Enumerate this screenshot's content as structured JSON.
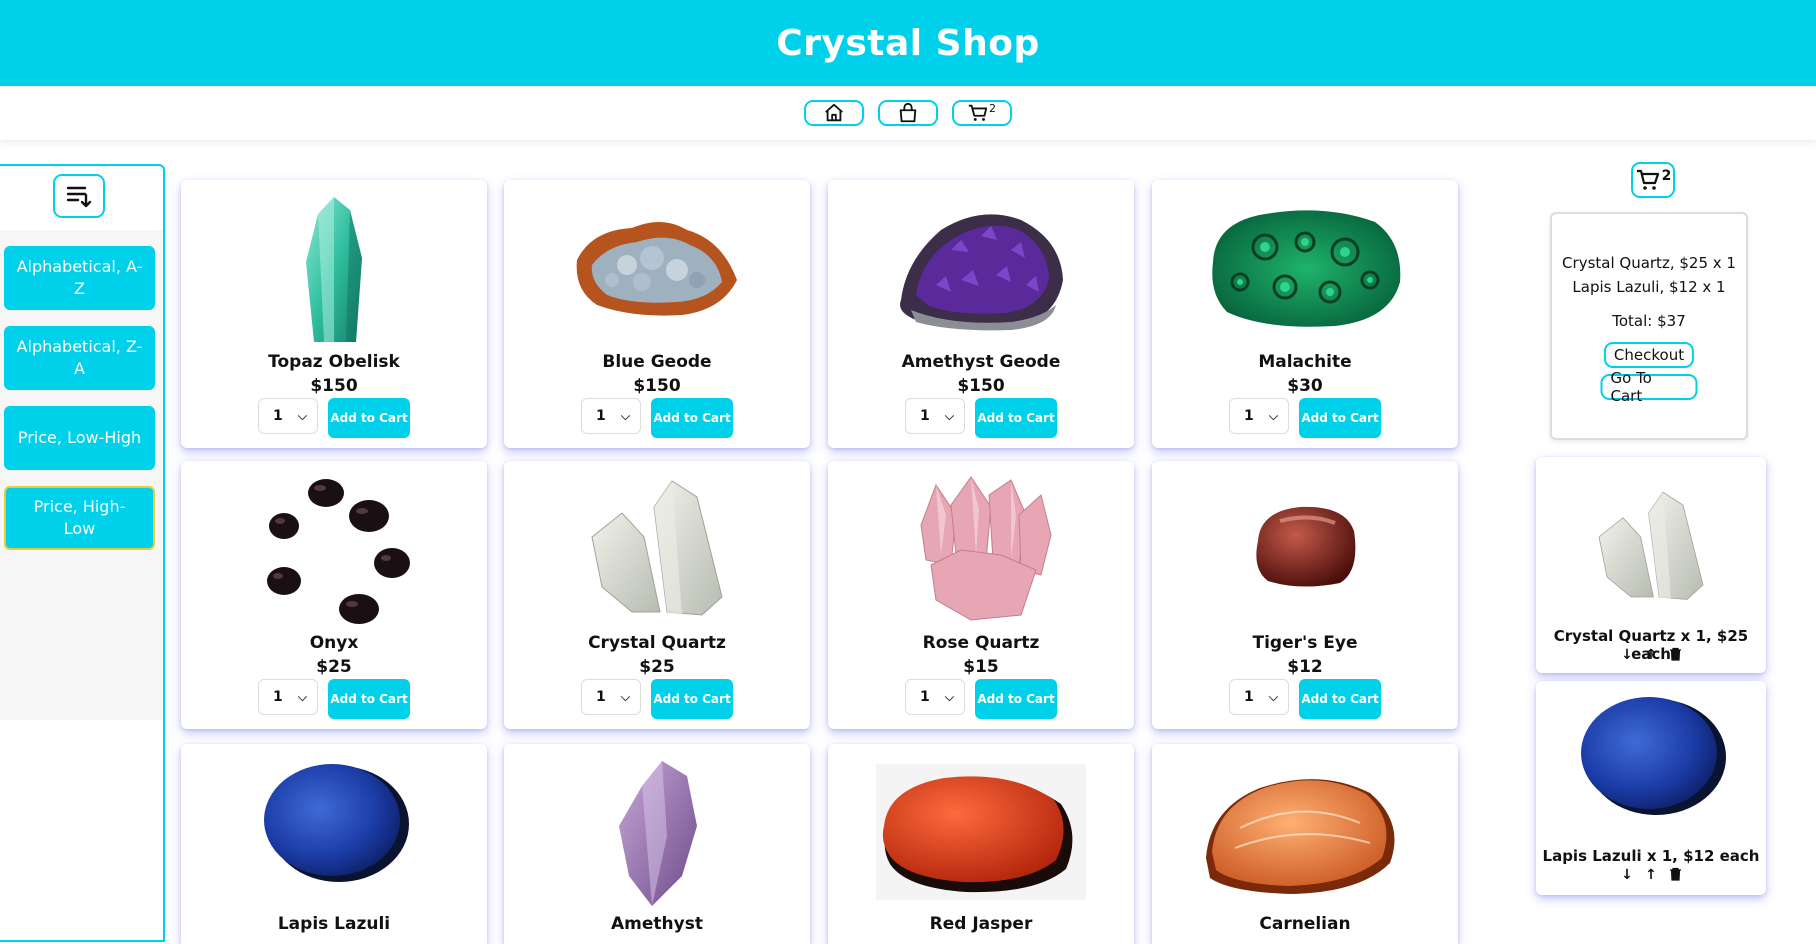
{
  "app": {
    "title": "Crystal Shop",
    "accent": "#00d1ea",
    "active_outline": "#e6cd38"
  },
  "nav": [
    {
      "icon": "home-icon"
    },
    {
      "icon": "shopping-bag-icon"
    },
    {
      "icon": "cart-icon",
      "count": "2"
    }
  ],
  "sidebar": {
    "sort_icon": "sort-descending-icon",
    "options": [
      {
        "label": "Alphabetical, A-Z",
        "active": false
      },
      {
        "label": "Alphabetical, Z-A",
        "active": false
      },
      {
        "label": "Price, Low-High",
        "active": false
      },
      {
        "label": "Price, High-Low",
        "active": true
      }
    ]
  },
  "products": [
    {
      "name": "Topaz Obelisk",
      "price": "$150",
      "qty": "1",
      "button": "Add to Cart",
      "image": "green-crystal-point"
    },
    {
      "name": "Blue Geode",
      "price": "$150",
      "qty": "1",
      "button": "Add to Cart",
      "image": "blue-geode"
    },
    {
      "name": "Amethyst Geode",
      "price": "$150",
      "qty": "1",
      "button": "Add to Cart",
      "image": "purple-geode"
    },
    {
      "name": "Malachite",
      "price": "$30",
      "qty": "1",
      "button": "Add to Cart",
      "image": "malachite-stone"
    },
    {
      "name": "Onyx",
      "price": "$25",
      "qty": "1",
      "button": "Add to Cart",
      "image": "onyx-stones"
    },
    {
      "name": "Crystal Quartz",
      "price": "$25",
      "qty": "1",
      "button": "Add to Cart",
      "image": "clear-quartz"
    },
    {
      "name": "Rose Quartz",
      "price": "$15",
      "qty": "1",
      "button": "Add to Cart",
      "image": "pink-quartz-cluster"
    },
    {
      "name": "Tiger's Eye",
      "price": "$12",
      "qty": "1",
      "button": "Add to Cart",
      "image": "tigers-eye-stone"
    },
    {
      "name": "Lapis Lazuli",
      "image": "lapis-stone"
    },
    {
      "name": "Amethyst",
      "image": "amethyst-point"
    },
    {
      "name": "Red Jasper",
      "image": "red-jasper-stone"
    },
    {
      "name": "Carnelian",
      "image": "carnelian-stone"
    }
  ],
  "cart": {
    "count": "2",
    "lines": [
      "Crystal Quartz, $25 x 1",
      "Lapis Lazuli, $12 x 1"
    ],
    "total": "Total: $37",
    "checkout": "Checkout",
    "go_to_cart": "Go To Cart",
    "items": [
      {
        "label": "Crystal Quartz x 1, $25 each",
        "image": "clear-quartz"
      },
      {
        "label": "Lapis Lazuli x 1, $12 each",
        "image": "lapis-stone"
      }
    ],
    "item_actions": [
      "↓",
      "↑"
    ]
  }
}
